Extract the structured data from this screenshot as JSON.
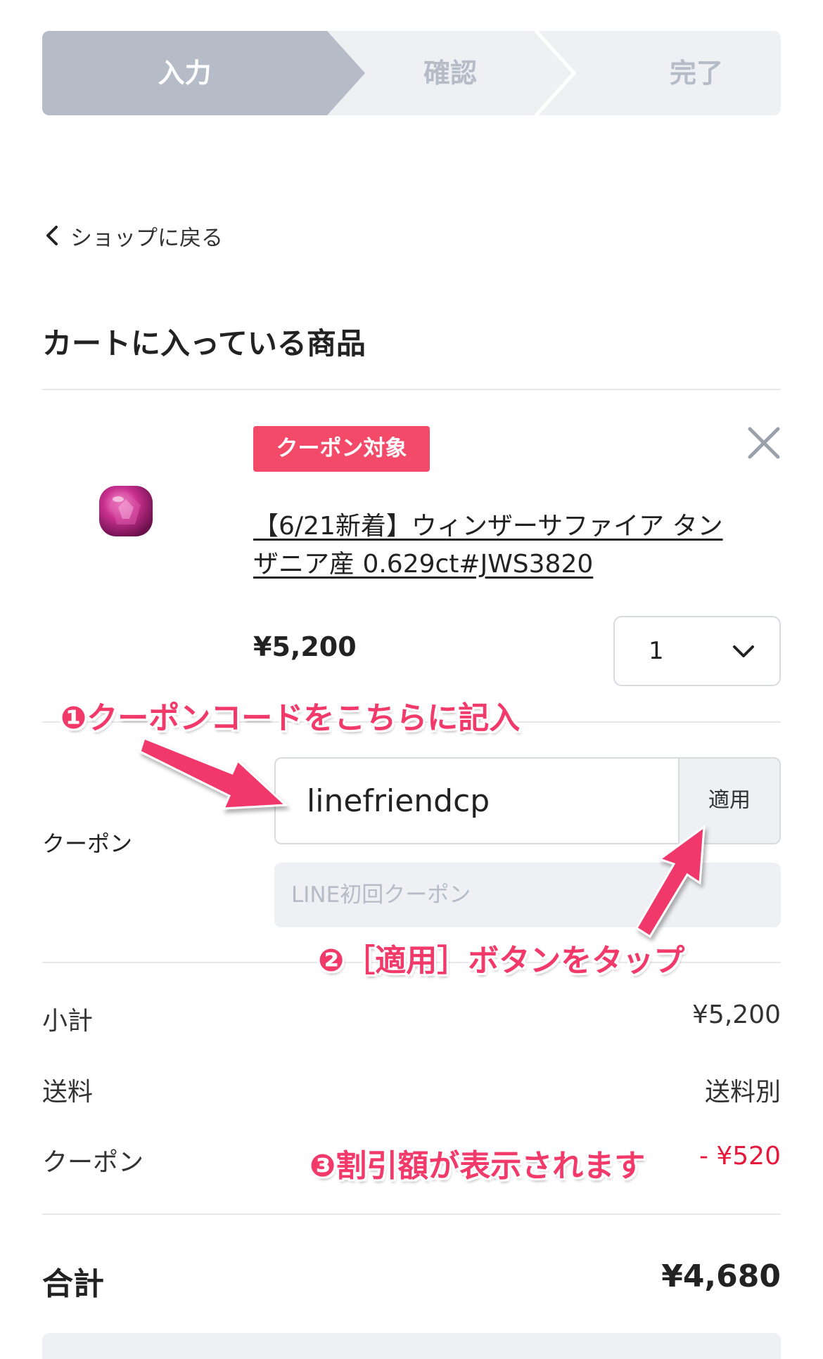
{
  "stepper": {
    "steps": [
      {
        "label": "入力",
        "active": true
      },
      {
        "label": "確認",
        "active": false
      },
      {
        "label": "完了",
        "active": false
      }
    ],
    "active_color": "#b5bcc7",
    "inactive_bg": "#eef0f3"
  },
  "nav": {
    "back_label": "ショップに戻る",
    "back_icon": "chevron-left-icon"
  },
  "cart": {
    "title": "カートに入っている商品",
    "item": {
      "badge": "クーポン対象",
      "badge_color": "#f24a68",
      "name": "【6/21新着】ウィンザーサファイア タンザニア産 0.629ct#JWS3820",
      "price": "¥5,200",
      "quantity": "1",
      "image_icon": "pink-gem-image",
      "remove_icon": "close-icon"
    }
  },
  "coupon": {
    "label": "クーポン",
    "code_value": "linefriendcp",
    "apply_label": "適用",
    "applied_name": "LINE初回クーポン"
  },
  "summary": {
    "subtotal_label": "小計",
    "subtotal_value": "¥5,200",
    "shipping_label": "送料",
    "shipping_value": "送料別",
    "coupon_label": "クーポン",
    "coupon_value": "- ¥520",
    "discount_color": "#e8173c",
    "total_label": "合計",
    "total_value": "¥4,680"
  },
  "annotations": {
    "step1": "❶クーポンコードをこちらに記入",
    "step2": "❷［適用］ボタンをタップ",
    "step3": "❸割引額が表示されます",
    "color": "#f1396a"
  }
}
